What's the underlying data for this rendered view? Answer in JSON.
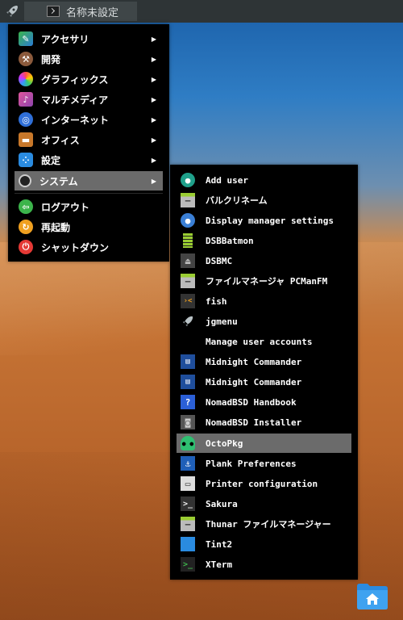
{
  "taskbar": {
    "launcher_icon": "rocket-icon",
    "task_label": "名称未設定"
  },
  "main_menu": {
    "items": [
      {
        "label": "アクセサリ",
        "icon": "accessories-icon",
        "submenu": true
      },
      {
        "label": "開発",
        "icon": "development-icon",
        "submenu": true
      },
      {
        "label": "グラフィックス",
        "icon": "graphics-icon",
        "submenu": true
      },
      {
        "label": "マルチメディア",
        "icon": "multimedia-icon",
        "submenu": true
      },
      {
        "label": "インターネット",
        "icon": "internet-icon",
        "submenu": true
      },
      {
        "label": "オフィス",
        "icon": "office-icon",
        "submenu": true
      },
      {
        "label": "設定",
        "icon": "settings-icon",
        "submenu": true
      },
      {
        "label": "システム",
        "icon": "system-icon",
        "submenu": true,
        "selected": true
      }
    ],
    "session": [
      {
        "label": "ログアウト",
        "icon": "logout-icon"
      },
      {
        "label": "再起動",
        "icon": "reboot-icon"
      },
      {
        "label": "シャットダウン",
        "icon": "shutdown-icon"
      }
    ]
  },
  "system_submenu": {
    "items": [
      {
        "label": "Add user",
        "icon": "add-user-icon"
      },
      {
        "label": "バルクリネーム",
        "icon": "bulk-rename-icon"
      },
      {
        "label": "Display manager settings",
        "icon": "display-manager-icon"
      },
      {
        "label": "DSBBatmon",
        "icon": "battery-icon"
      },
      {
        "label": "DSBMC",
        "icon": "eject-icon"
      },
      {
        "label": "ファイルマネージャ PCManFM",
        "icon": "file-manager-icon"
      },
      {
        "label": "fish",
        "icon": "fish-terminal-icon"
      },
      {
        "label": "jgmenu",
        "icon": "rocket-icon"
      },
      {
        "label": "Manage user accounts",
        "icon": ""
      },
      {
        "label": "Midnight Commander",
        "icon": "midnight-commander-icon"
      },
      {
        "label": "Midnight Commander",
        "icon": "midnight-commander-icon"
      },
      {
        "label": "NomadBSD Handbook",
        "icon": "help-icon"
      },
      {
        "label": "NomadBSD Installer",
        "icon": "installer-icon"
      },
      {
        "label": "OctoPkg",
        "icon": "octopkg-icon",
        "selected": true
      },
      {
        "label": "Plank Preferences",
        "icon": "plank-icon"
      },
      {
        "label": "Printer configuration",
        "icon": "printer-icon"
      },
      {
        "label": "Sakura",
        "icon": "terminal-icon"
      },
      {
        "label": "Thunar ファイルマネージャー",
        "icon": "file-manager-icon"
      },
      {
        "label": "Tint2",
        "icon": "tint2-icon"
      },
      {
        "label": "XTerm",
        "icon": "xterm-icon"
      }
    ]
  },
  "desktop": {
    "icons": [
      {
        "icon": "home-folder-icon"
      }
    ]
  },
  "colors": {
    "menu_bg": "#000000",
    "selection": "#6b6b6b",
    "taskbar": "#2e3436"
  }
}
